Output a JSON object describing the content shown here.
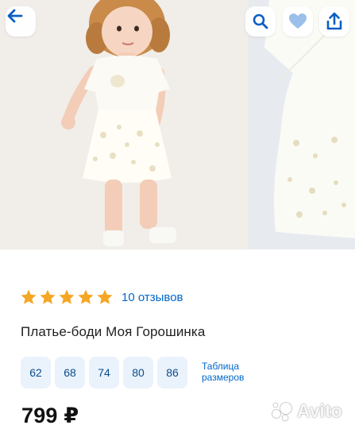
{
  "toolbar": {
    "back_icon": "arrow-left-icon",
    "search_icon": "search-icon",
    "favorite_icon": "heart-icon",
    "share_icon": "share-icon",
    "accent_color": "#0a5ec4"
  },
  "product": {
    "rating_value": 5,
    "rating_max": 5,
    "star_color": "#f5a623",
    "reviews_label": "10 отзывов",
    "title": "Платье-боди Моя Горошинка",
    "sizes": [
      "62",
      "68",
      "74",
      "80",
      "86"
    ],
    "size_table_label_line1": "Таблица",
    "size_table_label_line2": "размеров",
    "price": "799 ₽"
  },
  "watermark": {
    "text": "Avito"
  }
}
